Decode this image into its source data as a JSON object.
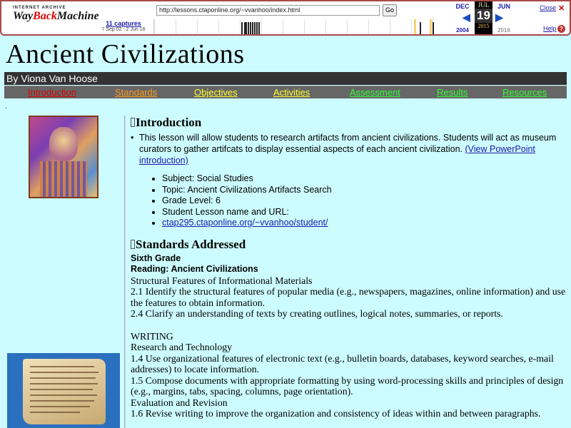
{
  "wayback": {
    "logo_top": "INTERNET ARCHIVE",
    "logo_main_a": "Way",
    "logo_main_b": "Back",
    "logo_main_c": "Machine",
    "url": "http://lessons.ctaponline.org/~vvanhoo/index.html",
    "go_label": "Go",
    "captures_label": "11 captures",
    "captures_range": "7 Sep 02 - 2 Jun 16",
    "prev_month": "DEC",
    "cur_month": "JUL",
    "next_month": "JUN",
    "cur_day": "19",
    "prev_year": "2004",
    "cur_year": "2015",
    "next_year": "2016",
    "close_label": "Close",
    "help_label": "Help"
  },
  "page": {
    "title": "Ancient Civilizations",
    "byline": "By Viona Van Hoose"
  },
  "nav": [
    {
      "label": "Introduction",
      "color": "#d80000"
    },
    {
      "label": "Standards",
      "color": "#ff9a1a"
    },
    {
      "label": "Objectives",
      "color": "#ffff33"
    },
    {
      "label": "Activities",
      "color": "#ffff33"
    },
    {
      "label": "Assessment",
      "color": "#33ff33"
    },
    {
      "label": "Results",
      "color": "#33ff33"
    },
    {
      "label": "Resources",
      "color": "#33ff33"
    }
  ],
  "colors": {
    "background": "#ccfcff",
    "byline_bg": "#333333",
    "nav_bg": "#666666",
    "link": "#1a1aaa"
  },
  "intro": {
    "heading": "Introduction",
    "bullet_text": "This lesson will allow students to research artifacts from ancient civilizations.  Students will act as museum curators to gather artifcats to display essential aspects of each ancient civilization. ",
    "bullet_link": "(View PowerPoint introduction)",
    "meta": [
      "Subject:  Social Studies",
      "Topic: Ancient Civilizations Artifacts Search",
      "Grade Level: 6",
      "Student Lesson name and URL:"
    ],
    "student_url": "ctap295.ctaponline.org/~vvanhoo/student/"
  },
  "standards": {
    "heading": "Standards Addressed",
    "grade": "Sixth Grade",
    "reading_label": "Reading:  Ancient Civilizations",
    "lines_a": [
      "Structural Features of Informational Materials",
      "2.1 Identify the structural features of popular media (e.g., newspapers, magazines, online information) and use the features to obtain information.",
      "2.4 Clarify an understanding of texts by creating outlines, logical notes, summaries, or reports."
    ],
    "lines_b": [
      "WRITING",
      "Research and Technology",
      "1.4 Use organizational features of electronic text (e.g., bulletin boards, databases, keyword searches, e-mail addresses) to locate information.",
      "1.5 Compose documents with appropriate formatting by using word-processing skills and principles of design (e.g., margins, tabs, spacing, columns, page orientation).",
      "Evaluation and Revision",
      "1.6 Revise writing to improve the organization and consistency of ideas within and between paragraphs."
    ]
  },
  "icons": {
    "close": "close-icon",
    "help": "help-icon",
    "prev": "prev-arrow-icon",
    "next": "next-arrow-icon"
  }
}
